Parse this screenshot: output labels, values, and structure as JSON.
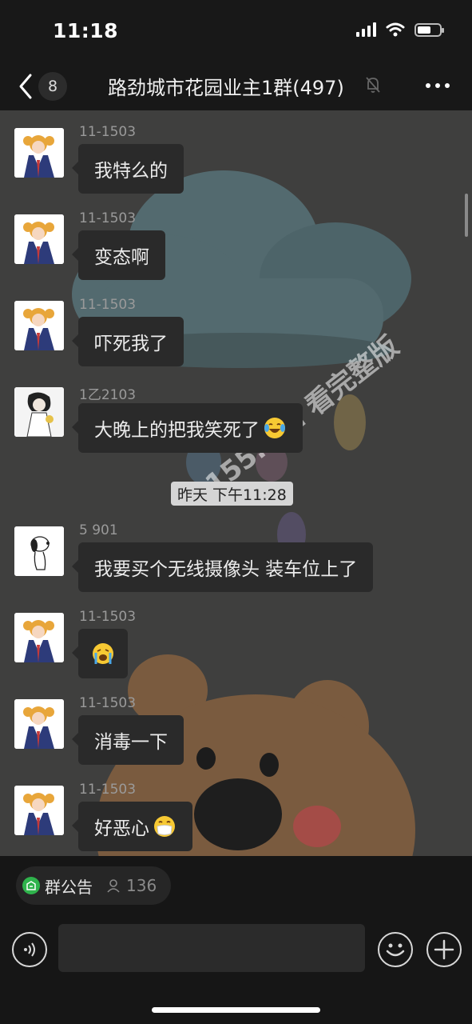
{
  "status": {
    "time": "11:18",
    "battery_level": 0.6
  },
  "nav": {
    "unread_count": "8",
    "title": "路劲城市花园业主1群(497)"
  },
  "messages": [
    {
      "sender": "11-1503",
      "text": "我特么的",
      "avatar": "anime-girl"
    },
    {
      "sender": "11-1503",
      "text": "变态啊",
      "avatar": "anime-girl"
    },
    {
      "sender": "11-1503",
      "text": "吓死我了",
      "avatar": "anime-girl"
    },
    {
      "sender": "1乙2103",
      "text": "大晚上的把我笑死了",
      "emoji": "joy",
      "avatar": "sketch-woman"
    },
    {
      "sender": "5 901",
      "text": "我要买个无线摄像头 装车位上了",
      "avatar": "snoopy"
    },
    {
      "sender": "11-1503",
      "text": "",
      "emoji": "loudly-crying",
      "avatar": "anime-girl"
    },
    {
      "sender": "11-1503",
      "text": "消毒一下",
      "avatar": "anime-girl"
    },
    {
      "sender": "11-1503",
      "text": "好恶心",
      "emoji": "mask-face",
      "avatar": "anime-girl"
    }
  ],
  "timestamp": "昨天 下午11:28",
  "watermark": "155.fun 看完整版",
  "notice": {
    "label": "群公告",
    "member_count": "136"
  },
  "input": {
    "placeholder": ""
  },
  "colors": {
    "bubble": "#2a2a2a",
    "notice_green": "#2fb34c",
    "bar_bg": "#181818"
  }
}
